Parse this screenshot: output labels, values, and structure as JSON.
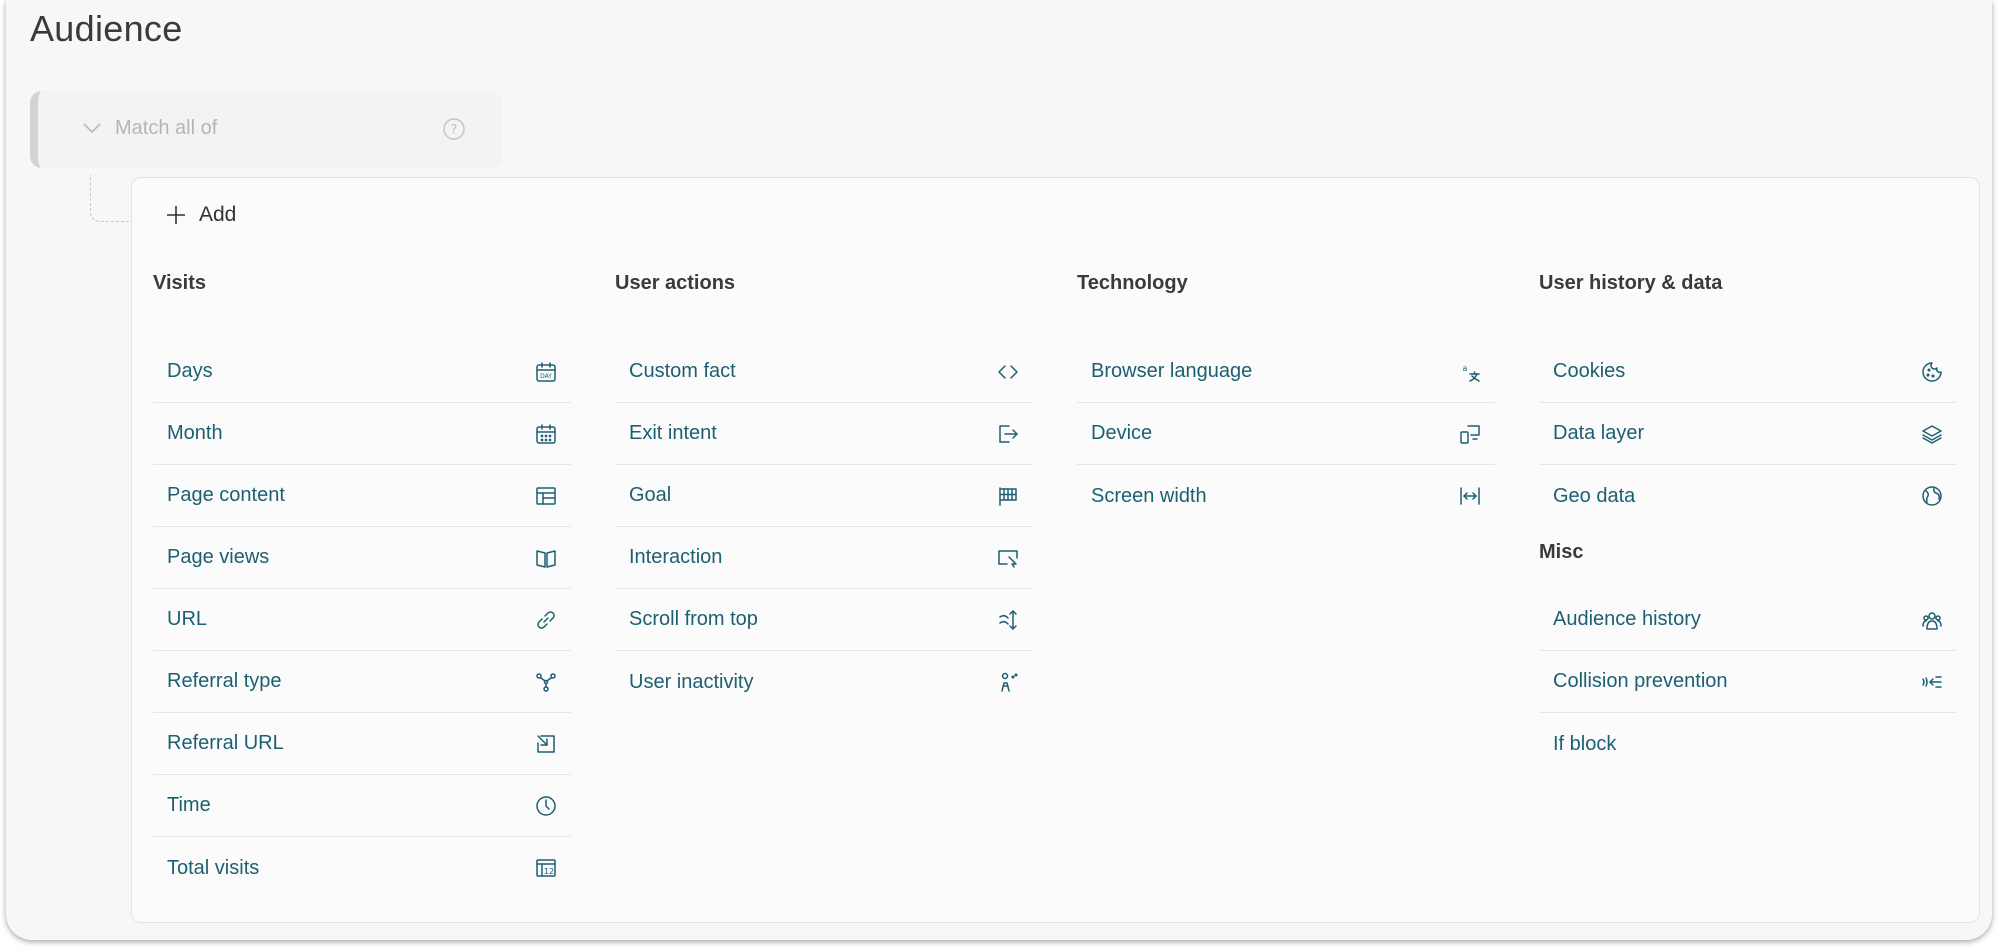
{
  "page": {
    "title": "Audience"
  },
  "match": {
    "label": "Match all of"
  },
  "add": {
    "label": "Add"
  },
  "columns": [
    {
      "title": "Visits",
      "items": [
        {
          "label": "Days",
          "icon": "calendar-day-icon"
        },
        {
          "label": "Month",
          "icon": "calendar-month-icon"
        },
        {
          "label": "Page content",
          "icon": "layout-icon"
        },
        {
          "label": "Page views",
          "icon": "book-open-icon"
        },
        {
          "label": "URL",
          "icon": "link-icon"
        },
        {
          "label": "Referral type",
          "icon": "share-nodes-icon"
        },
        {
          "label": "Referral URL",
          "icon": "arrow-in-box-icon"
        },
        {
          "label": "Time",
          "icon": "clock-icon"
        },
        {
          "label": "Total visits",
          "icon": "counter-icon"
        }
      ]
    },
    {
      "title": "User actions",
      "items": [
        {
          "label": "Custom fact",
          "icon": "code-icon"
        },
        {
          "label": "Exit intent",
          "icon": "exit-icon"
        },
        {
          "label": "Goal",
          "icon": "flag-icon"
        },
        {
          "label": "Interaction",
          "icon": "cursor-click-icon"
        },
        {
          "label": "Scroll from top",
          "icon": "scroll-icon"
        },
        {
          "label": "User inactivity",
          "icon": "user-idle-icon"
        }
      ]
    },
    {
      "title": "Technology",
      "items": [
        {
          "label": "Browser language",
          "icon": "translate-icon"
        },
        {
          "label": "Device",
          "icon": "devices-icon"
        },
        {
          "label": "Screen width",
          "icon": "width-icon"
        }
      ]
    },
    {
      "title": "User history & data",
      "items": [
        {
          "label": "Cookies",
          "icon": "cookie-icon"
        },
        {
          "label": "Data layer",
          "icon": "layers-icon"
        },
        {
          "label": "Geo data",
          "icon": "globe-icon"
        }
      ],
      "misc_title": "Misc",
      "misc_items": [
        {
          "label": "Audience history",
          "icon": "audience-icon"
        },
        {
          "label": "Collision prevention",
          "icon": "collision-icon"
        },
        {
          "label": "If block",
          "icon": ""
        }
      ]
    }
  ]
}
